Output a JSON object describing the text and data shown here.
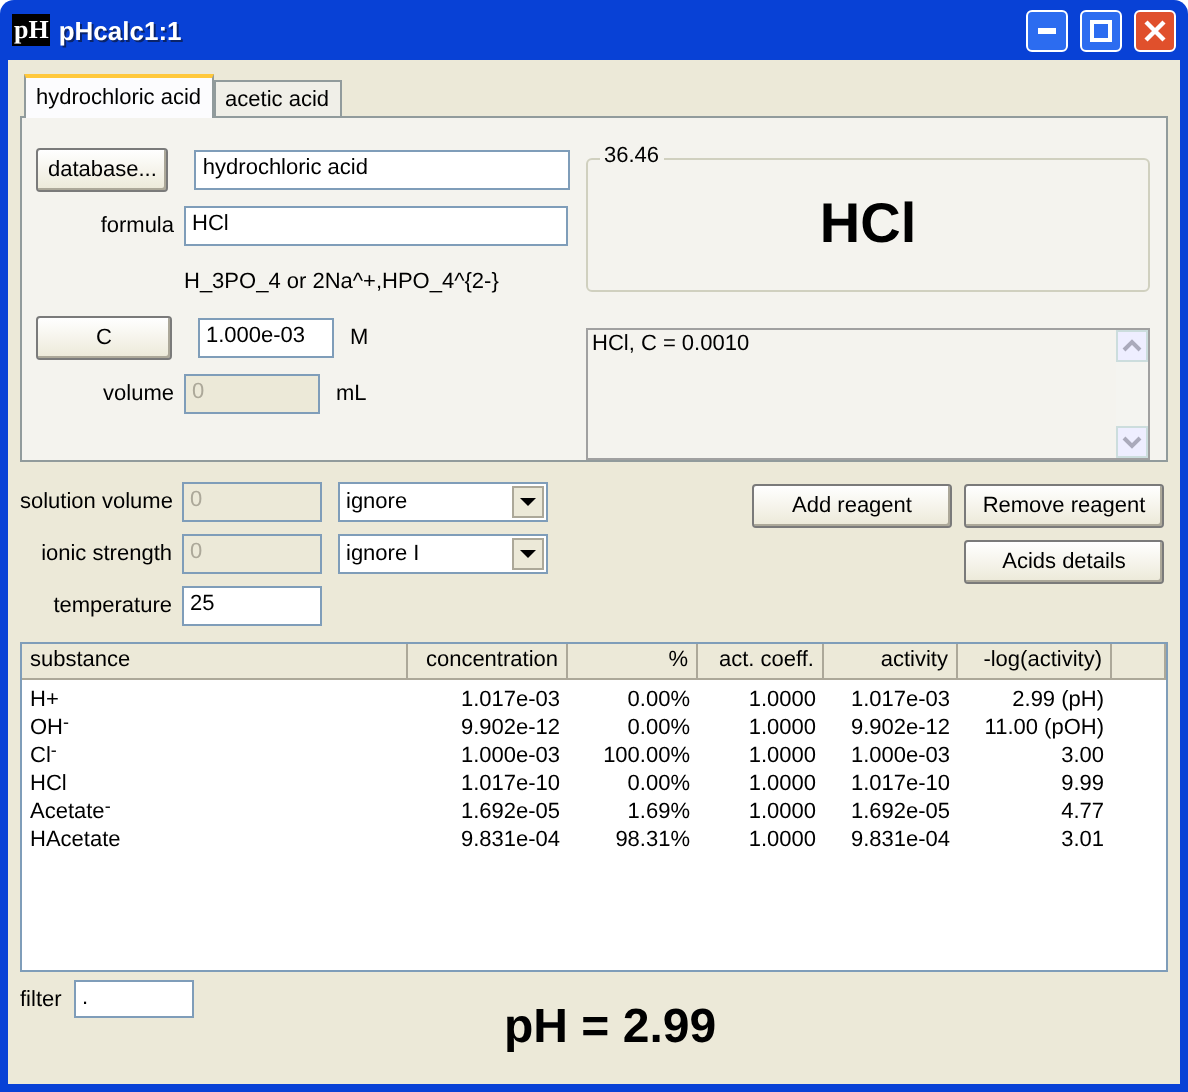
{
  "window": {
    "title": "pHcalc1:1",
    "icon_text": "pH"
  },
  "tabs": [
    {
      "label": "hydrochloric acid",
      "selected": true
    },
    {
      "label": "acetic acid",
      "selected": false
    }
  ],
  "reagent": {
    "database_button": "database...",
    "name": {
      "value": "hydrochloric acid",
      "disabled": false
    },
    "formula_label": "formula",
    "formula": {
      "value": "HCl",
      "disabled": false
    },
    "formula_hint": "H_3PO_4 or 2Na^+,HPO_4^{2-}",
    "c_button": "C",
    "concentration": {
      "value": "1.000e-03",
      "disabled": false
    },
    "concentration_unit": "M",
    "volume_label": "volume",
    "volume": {
      "value": "0",
      "disabled": true
    },
    "volume_unit": "mL",
    "molar_mass": "36.46",
    "formula_display": "HCl",
    "summary": "HCl, C = 0.0010"
  },
  "settings": [
    {
      "label": "solution volume",
      "field": {
        "value": "0",
        "disabled": true
      },
      "select": "ignore"
    },
    {
      "label": "ionic strength",
      "field": {
        "value": "0",
        "disabled": true
      },
      "select": "ignore I"
    },
    {
      "label": "temperature",
      "field": {
        "value": "25",
        "disabled": false
      }
    }
  ],
  "buttons": {
    "add": "Add reagent",
    "remove": "Remove reagent",
    "details": "Acids details"
  },
  "table": {
    "columns": [
      "substance",
      "concentration",
      "%",
      "act. coeff.",
      "activity",
      "-log(activity)"
    ],
    "rows": [
      [
        "H+",
        "1.017e-03",
        "0.00%",
        "1.0000",
        "1.017e-03",
        "2.99 (pH)"
      ],
      [
        "OH$^{-}$",
        "9.902e-12",
        "0.00%",
        "1.0000",
        "9.902e-12",
        "11.00 (pOH)"
      ],
      [
        "Cl$^{-}$",
        "1.000e-03",
        "100.00%",
        "1.0000",
        "1.000e-03",
        "3.00"
      ],
      [
        "HCl",
        "1.017e-10",
        "0.00%",
        "1.0000",
        "1.017e-10",
        "9.99"
      ],
      [
        "Acetate$^{-}$",
        "1.692e-05",
        "1.69%",
        "1.0000",
        "1.692e-05",
        "4.77"
      ],
      [
        "HAcetate",
        "9.831e-04",
        "98.31%",
        "1.0000",
        "9.831e-04",
        "3.01"
      ]
    ]
  },
  "filter": {
    "label": "filter",
    "value": "."
  },
  "result": "pH = 2.99"
}
